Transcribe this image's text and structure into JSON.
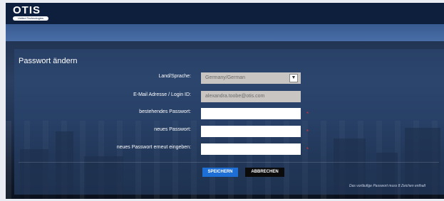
{
  "brand": {
    "logo_text": "OTIS",
    "logo_tagline": "United Technologies"
  },
  "form": {
    "title": "Passwort ändern",
    "fields": [
      {
        "label": "Land/Sprache:",
        "value": "Germany/German",
        "placeholder": "",
        "type": "select",
        "required": false
      },
      {
        "label": "E-Mail Adresse / Login ID:",
        "value": "alexandra.toobe@otis.com",
        "placeholder": "",
        "type": "readonly",
        "required": false
      },
      {
        "label": "bestehendes Passwort:",
        "value": "",
        "placeholder": "",
        "type": "password",
        "required": true
      },
      {
        "label": "neues Passwort:",
        "value": "",
        "placeholder": "",
        "type": "password",
        "required": true
      },
      {
        "label": "neues Passwort erneut eingeben:",
        "value": "",
        "placeholder": "",
        "type": "password",
        "required": true
      }
    ],
    "required_marker": "*",
    "save_label": "SPEICHERN",
    "cancel_label": "ABBRECHEN",
    "hint": "Das vorläufige Passwort muss 8 Zeichen enthalt"
  },
  "colors": {
    "header": "#0d1f3c",
    "bar": "#3a5f98",
    "save_button": "#1d6fd6",
    "cancel_button": "#0b0b0b",
    "required": "#e03030"
  },
  "icons": {
    "select_arrow": "chevron-down-icon"
  }
}
